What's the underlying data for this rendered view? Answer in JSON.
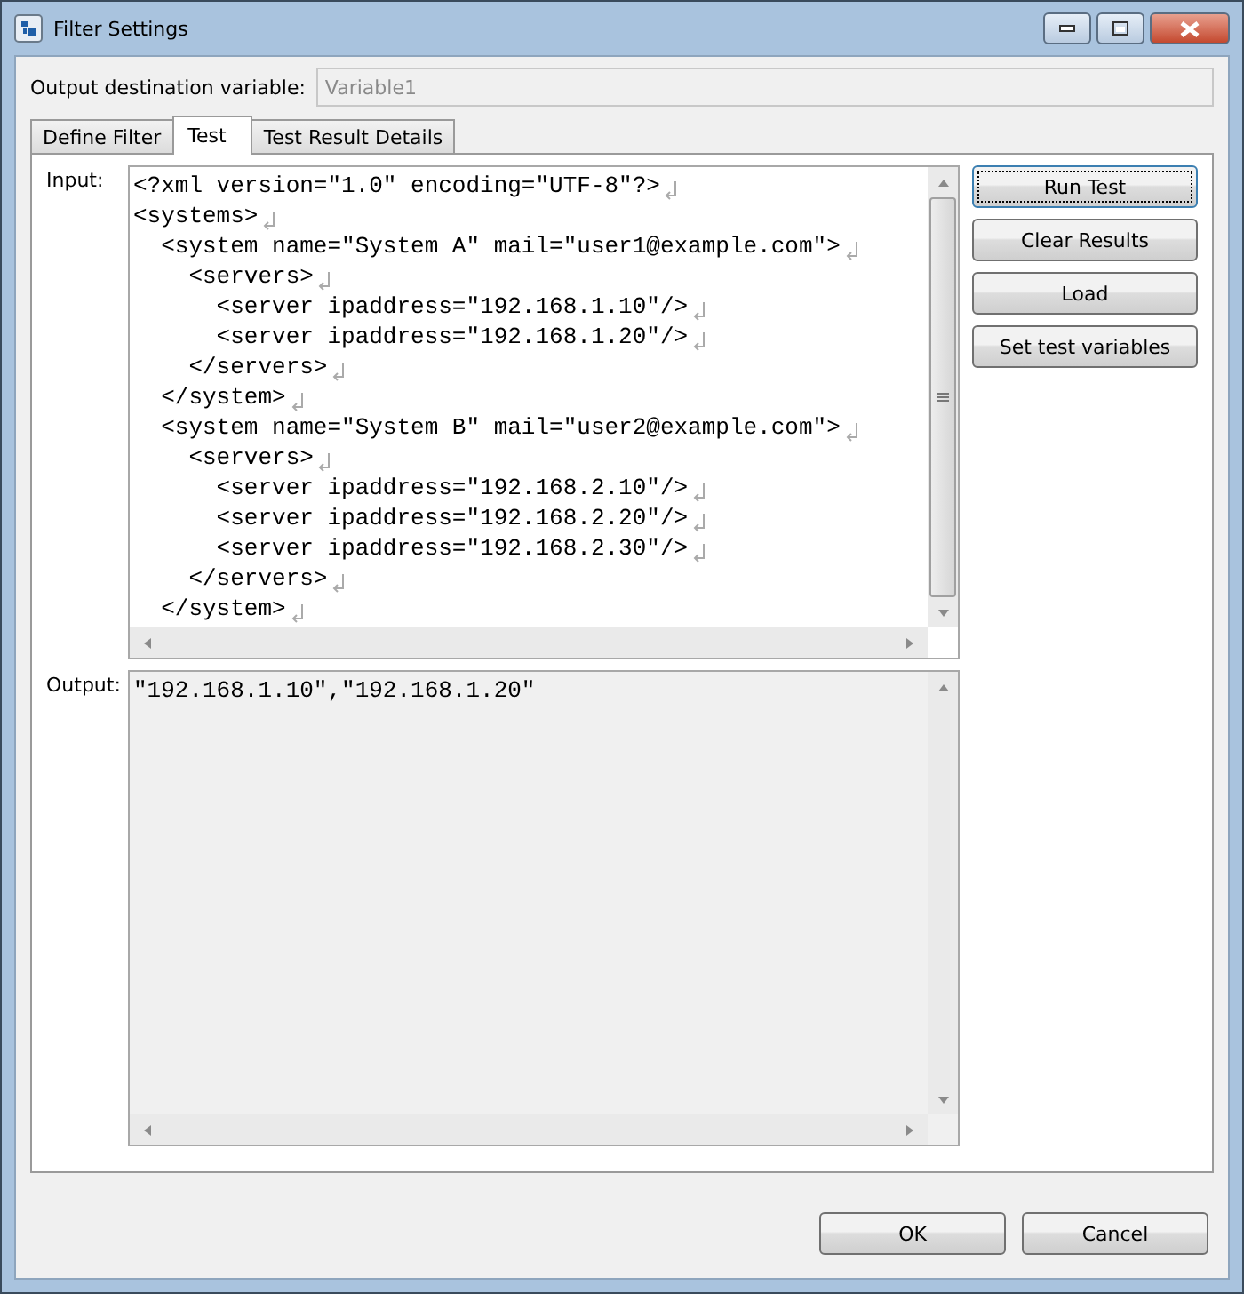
{
  "window": {
    "title": "Filter Settings"
  },
  "output_variable": {
    "label": "Output destination variable:",
    "value": "Variable1",
    "disabled": true
  },
  "tabs": [
    {
      "label": "Define Filter",
      "selected": false
    },
    {
      "label": "Test",
      "selected": true
    },
    {
      "label": "Test Result Details",
      "selected": false
    }
  ],
  "input": {
    "label": "Input:",
    "lines": [
      "<?xml version=\"1.0\" encoding=\"UTF-8\"?>",
      "<systems>",
      "  <system name=\"System A\" mail=\"user1@example.com\">",
      "    <servers>",
      "      <server ipaddress=\"192.168.1.10\"/>",
      "      <server ipaddress=\"192.168.1.20\"/>",
      "    </servers>",
      "  </system>",
      "  <system name=\"System B\" mail=\"user2@example.com\">",
      "    <servers>",
      "      <server ipaddress=\"192.168.2.10\"/>",
      "      <server ipaddress=\"192.168.2.20\"/>",
      "      <server ipaddress=\"192.168.2.30\"/>",
      "    </servers>",
      "  </system>"
    ]
  },
  "output": {
    "label": "Output:",
    "value": "\"192.168.1.10\",\"192.168.1.20\""
  },
  "side_buttons": [
    {
      "label": "Run Test",
      "focused": true
    },
    {
      "label": "Clear Results",
      "focused": false
    },
    {
      "label": "Load",
      "focused": false
    },
    {
      "label": "Set test variables",
      "focused": false
    }
  ],
  "buttons": [
    "OK",
    "Cancel"
  ]
}
